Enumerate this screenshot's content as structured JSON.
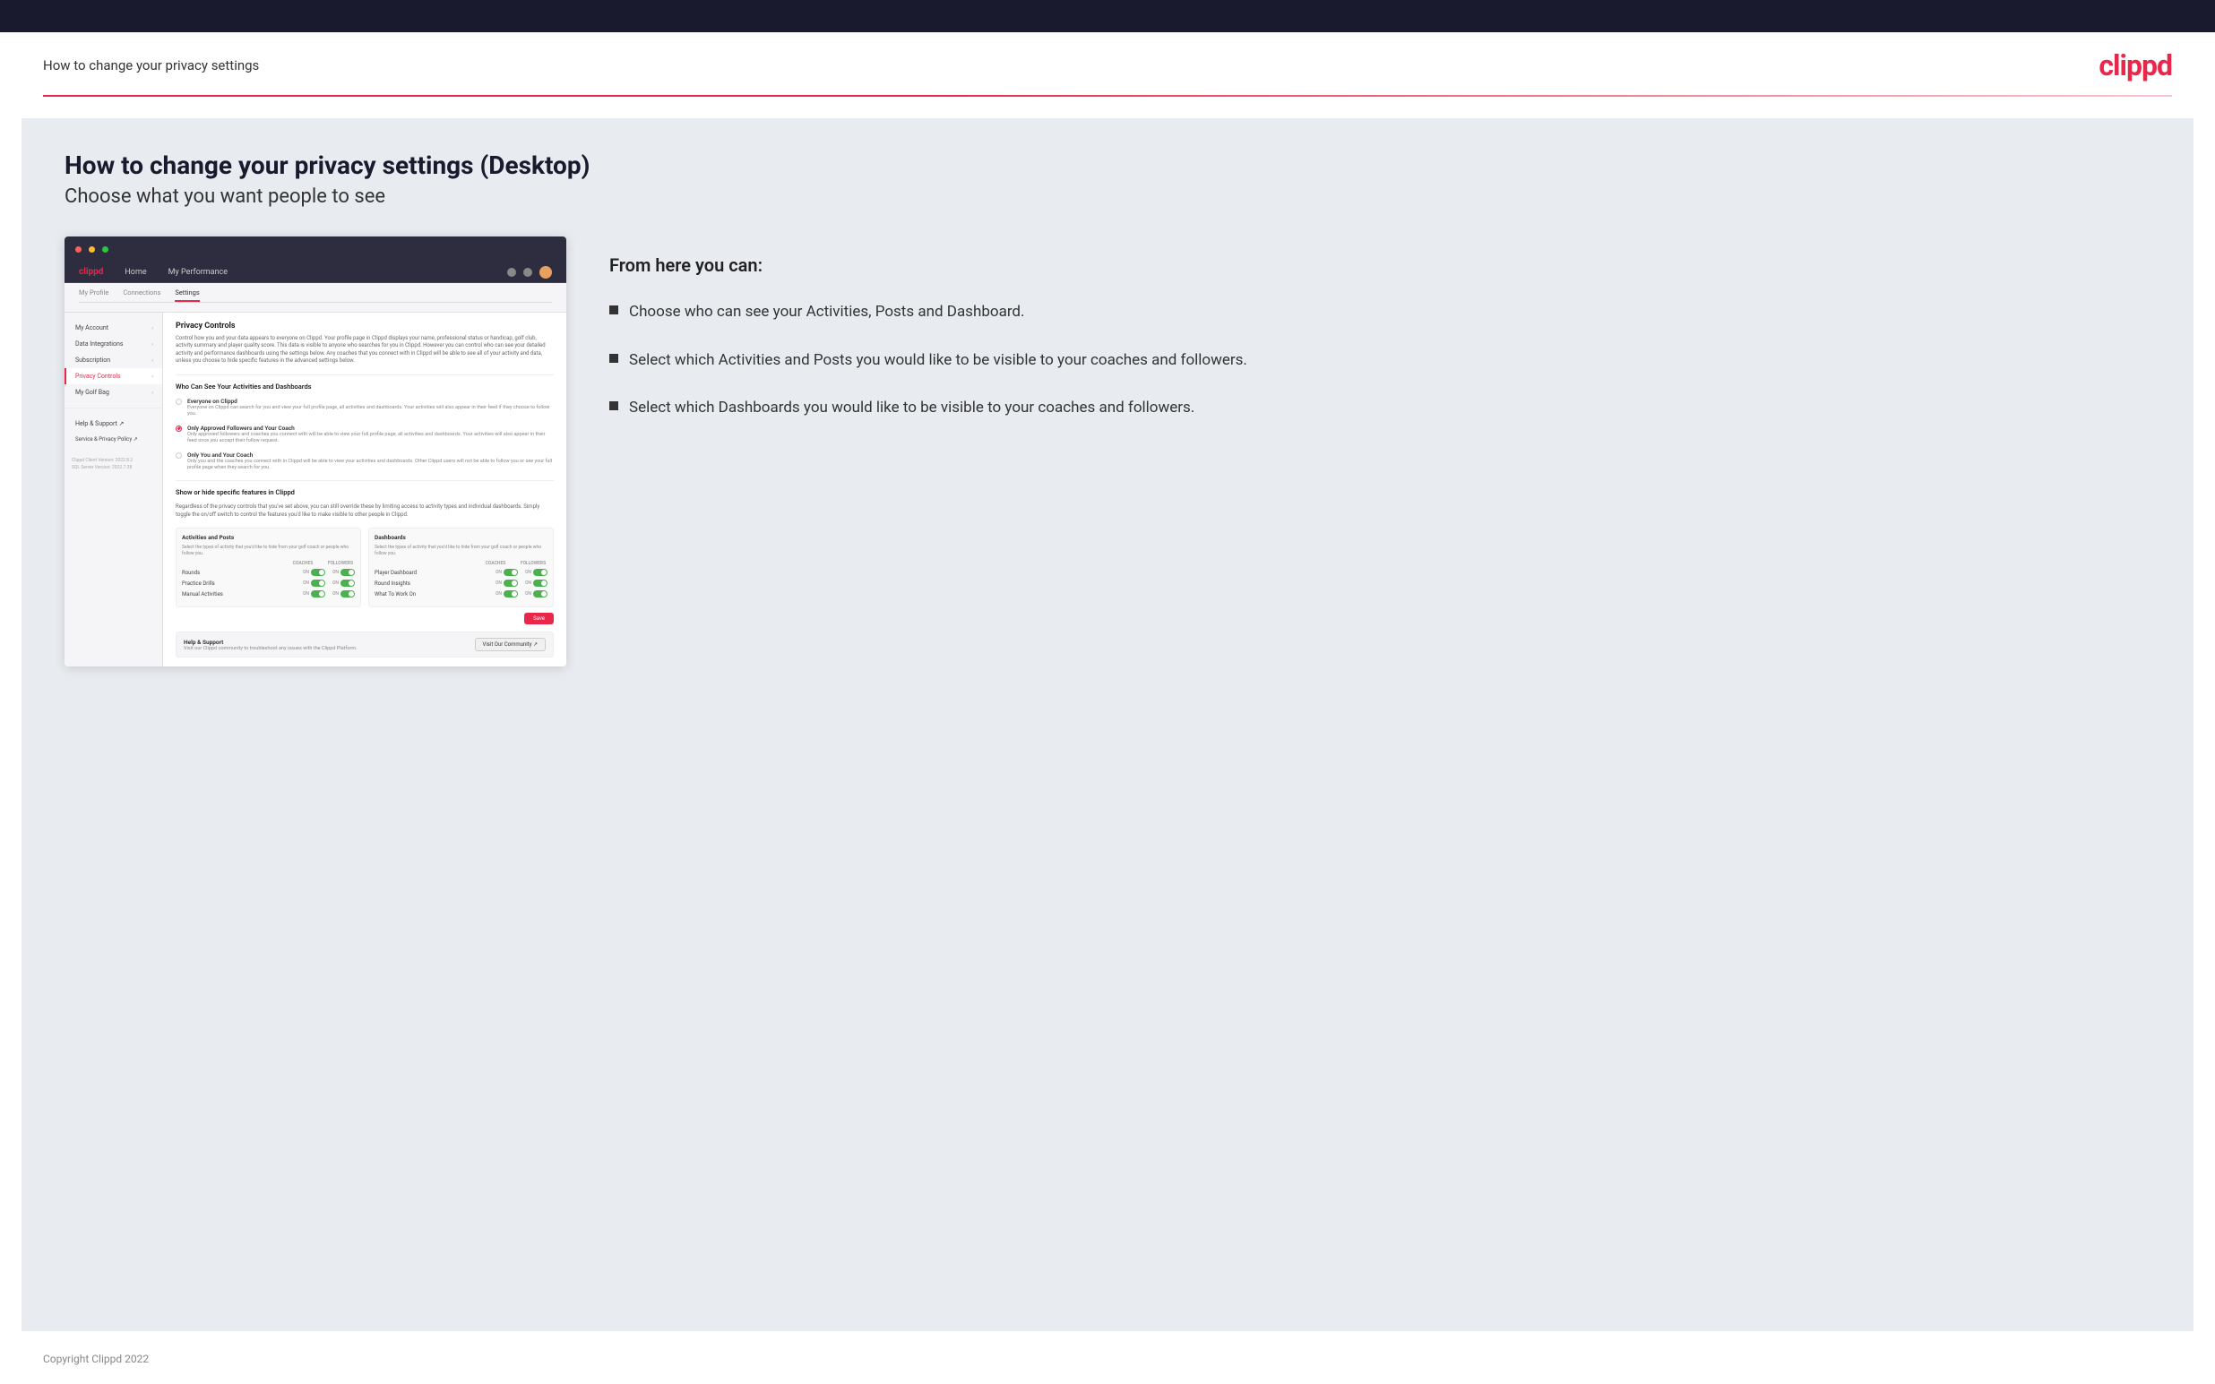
{
  "topbar": {},
  "header": {
    "title": "How to change your privacy settings",
    "logo": "clippd"
  },
  "page": {
    "heading": "How to change your privacy settings (Desktop)",
    "subheading": "Choose what you want people to see"
  },
  "screenshot": {
    "nav": {
      "logo": "clippd",
      "items": [
        "Home",
        "My Performance"
      ]
    },
    "tabs": [
      "My Profile",
      "Connections",
      "Settings"
    ],
    "sidebar": {
      "items": [
        {
          "label": "My Account",
          "active": false
        },
        {
          "label": "Data Integrations",
          "active": false
        },
        {
          "label": "Subscription",
          "active": false
        },
        {
          "label": "Privacy Controls",
          "active": true
        },
        {
          "label": "My Golf Bag",
          "active": false
        },
        {
          "label": "Help & Support",
          "active": false
        },
        {
          "label": "Service & Privacy Policy",
          "active": false
        }
      ],
      "version": "Clippd Client Version: 2022.8.2\nSQL Server Version: 2022.7.38"
    },
    "privacy_controls": {
      "title": "Privacy Controls",
      "desc": "Control how you and your data appears to everyone on Clippd. Your profile page in Clippd displays your name, professional status or handicap, golf club, activity summary and player quality score. This data is visible to anyone who searches for you in Clippd. However you can control who can see your detailed activity and performance dashboards using the settings below. Any coaches that you connect with in Clippd will be able to see all of your activity and data, unless you choose to hide specific features in the advanced settings below.",
      "who_can_see_title": "Who Can See Your Activities and Dashboards",
      "options": [
        {
          "label": "Everyone on Clippd",
          "desc": "Everyone on Clippd can search for you and view your full profile page, all activities and dashboards. Your activities will also appear in their feed if they choose to follow you.",
          "checked": false
        },
        {
          "label": "Only Approved Followers and Your Coach",
          "desc": "Only approved followers and coaches you connect with will be able to view your full profile page, all activities and dashboards. Your activities will also appear in their feed once you accept their follow request.",
          "checked": true
        },
        {
          "label": "Only You and Your Coach",
          "desc": "Only you and the coaches you connect with in Clippd will be able to view your activities and dashboards. Other Clippd users will not be able to follow you or see your full profile page when they search for you.",
          "checked": false
        }
      ]
    },
    "show_hide": {
      "title": "Show or hide specific features in Clippd",
      "desc": "Regardless of the privacy controls that you've set above, you can still override these by limiting access to activity types and individual dashboards. Simply toggle the on/off switch to control the features you'd like to make visible to other people in Clippd.",
      "activities": {
        "title": "Activities and Posts",
        "desc": "Select the types of activity that you'd like to hide from your golf coach or people who follow you.",
        "headers": [
          "COACHES",
          "FOLLOWERS"
        ],
        "rows": [
          {
            "name": "Rounds",
            "coaches_on": true,
            "followers_on": true
          },
          {
            "name": "Practice Drills",
            "coaches_on": true,
            "followers_on": true
          },
          {
            "name": "Manual Activities",
            "coaches_on": true,
            "followers_on": true
          }
        ]
      },
      "dashboards": {
        "title": "Dashboards",
        "desc": "Select the types of activity that you'd like to hide from your golf coach or people who follow you.",
        "headers": [
          "COACHES",
          "FOLLOWERS"
        ],
        "rows": [
          {
            "name": "Player Dashboard",
            "coaches_on": true,
            "followers_on": true
          },
          {
            "name": "Round Insights",
            "coaches_on": true,
            "followers_on": true
          },
          {
            "name": "What To Work On",
            "coaches_on": true,
            "followers_on": true
          }
        ]
      }
    },
    "save_label": "Save",
    "help": {
      "title": "Help & Support",
      "desc": "Visit our Clippd community to troubleshoot any issues with the Clippd Platform.",
      "button": "Visit Our Community"
    }
  },
  "right_panel": {
    "title": "From here you can:",
    "bullets": [
      "Choose who can see your Activities, Posts and Dashboard.",
      "Select which Activities and Posts you would like to be visible to your coaches and followers.",
      "Select which Dashboards you would like to be visible to your coaches and followers."
    ]
  },
  "footer": {
    "copyright": "Copyright Clippd 2022"
  }
}
